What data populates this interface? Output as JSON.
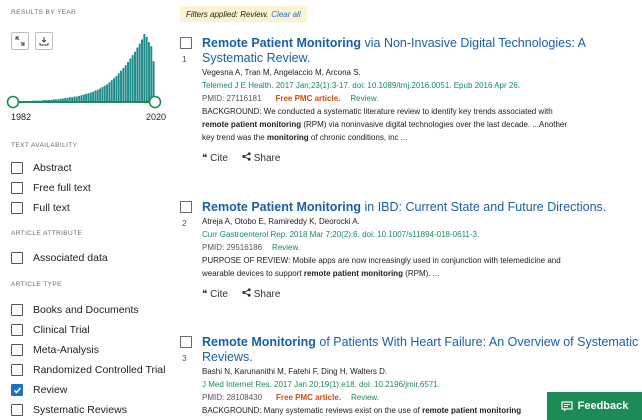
{
  "sidebar": {
    "results_by_year_title": "RESULTS BY YEAR",
    "histogram": [
      1,
      1,
      1,
      1,
      1,
      1,
      1,
      1,
      2,
      2,
      2,
      2,
      2,
      3,
      3,
      3,
      3,
      4,
      4,
      4,
      5,
      5,
      6,
      6,
      7,
      7,
      8,
      8,
      9,
      10,
      11,
      12,
      13,
      14,
      15,
      17,
      18,
      20,
      22,
      24,
      26,
      29,
      32,
      35,
      38,
      42,
      46,
      50,
      54,
      59,
      64,
      69,
      74,
      80,
      86,
      92,
      100,
      96,
      88,
      82,
      60
    ],
    "year_start": "1982",
    "year_end": "2020",
    "text_availability_title": "TEXT AVAILABILITY",
    "text_availability": [
      {
        "label": "Abstract",
        "checked": false
      },
      {
        "label": "Free full text",
        "checked": false
      },
      {
        "label": "Full text",
        "checked": false
      }
    ],
    "article_attribute_title": "ARTICLE ATTRIBUTE",
    "article_attribute": [
      {
        "label": "Associated data",
        "checked": false
      }
    ],
    "article_type_title": "ARTICLE TYPE",
    "article_type": [
      {
        "label": "Books and Documents",
        "checked": false
      },
      {
        "label": "Clinical Trial",
        "checked": false
      },
      {
        "label": "Meta-Analysis",
        "checked": false
      },
      {
        "label": "Randomized Controlled Trial",
        "checked": false
      },
      {
        "label": "Review",
        "checked": true
      },
      {
        "label": "Systematic Reviews",
        "checked": false
      }
    ]
  },
  "banner": {
    "text": "Filters applied: Review.",
    "clear": "Clear all"
  },
  "results": [
    {
      "num": "1",
      "title_bold": "Remote Patient Monitoring",
      "title_rest": " via Non-Invasive Digital Technologies: A Systematic Review.",
      "authors": "Vegesna A, Tran M, Angelaccio M, Arcona S.",
      "journal": "Telemed J E Health. 2017 Jan;23(1):3-17. doi: 10.1089/tmj.2016.0051. Epub 2016 Apr 26.",
      "pmid": "PMID: 27116181",
      "free": "Free PMC article.",
      "type": "Review.",
      "snippet_1a": "BACKGROUND: We conducted a systematic literature review to identify key trends associated with",
      "snippet_2b": "remote patient monitoring",
      "snippet_2c": " (RPM) via noninvasive digital technologies over the last decade. ...Another",
      "snippet_3a": "key trend was the ",
      "snippet_3b": "monitoring",
      "snippet_3c": " of chronic conditions, inc ...",
      "cite": "Cite",
      "share": "Share"
    },
    {
      "num": "2",
      "title_bold": "Remote Patient Monitoring",
      "title_rest": " in IBD: Current State and Future Directions.",
      "authors": "Atreja A, Otobo E, Ramireddy K, Deorocki A.",
      "journal": "Curr Gastroenterol Rep. 2018 Mar 7;20(2):6. doi: 10.1007/s11894-018-0611-3.",
      "pmid": "PMID: 29516186",
      "type": "Review.",
      "snippet_1a": "PURPOSE OF REVIEW: Mobile apps are now increasingly used in conjunction with telemedicine and",
      "snippet_2a": "wearable devices to support ",
      "snippet_2b": "remote patient monitoring",
      "snippet_2c": " (RPM). ...",
      "cite": "Cite",
      "share": "Share"
    },
    {
      "num": "3",
      "title_bold": "Remote Monitoring",
      "title_rest": " of Patients With Heart Failure: An Overview of Systematic Reviews.",
      "authors": "Bashi N, Karunanithi M, Fatehi F, Ding H, Walters D.",
      "journal": "J Med Internet Res. 2017 Jan 20;19(1):e18. doi: 10.2196/jmir.6571.",
      "pmid": "PMID: 28108430",
      "free": "Free PMC article.",
      "type": "Review.",
      "snippet_1a": "BACKGROUND: Many systematic reviews exist on the use of ",
      "snippet_1b": "remote patient monitoring"
    }
  ],
  "feedback": "Feedback",
  "colors": {
    "accent": "#1a73c9",
    "green": "#1e8a55",
    "pmc": "#d64a0f"
  }
}
